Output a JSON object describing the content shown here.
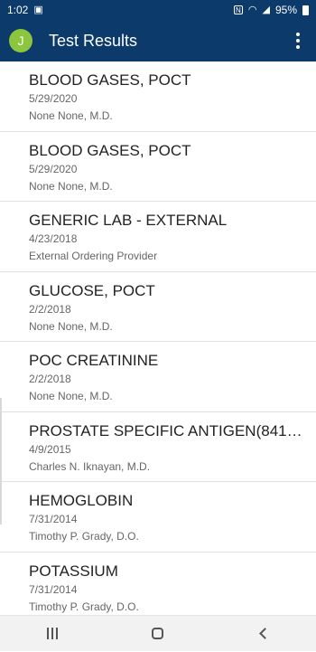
{
  "status_bar": {
    "time": "1:02",
    "battery": "95%",
    "icons": [
      "image-icon",
      "nfc-icon",
      "wifi-icon",
      "signal-icon",
      "battery-icon"
    ]
  },
  "app_bar": {
    "avatar_initial": "J",
    "title": "Test Results",
    "menu_icon": "more-vert-icon"
  },
  "results": [
    {
      "title": "BLOOD GASES, POCT",
      "date": "5/29/2020",
      "provider": "None None, M.D."
    },
    {
      "title": "BLOOD GASES, POCT",
      "date": "5/29/2020",
      "provider": "None None, M.D."
    },
    {
      "title": "GENERIC LAB - EXTERNAL",
      "date": "4/23/2018",
      "provider": "External Ordering Provider"
    },
    {
      "title": "GLUCOSE, POCT",
      "date": "2/2/2018",
      "provider": "None None, M.D."
    },
    {
      "title": "POC CREATININE",
      "date": "2/2/2018",
      "provider": "None None, M.D."
    },
    {
      "title": "PROSTATE SPECIFIC ANTIGEN(841…",
      "date": "4/9/2015",
      "provider": "Charles N. Iknayan, M.D."
    },
    {
      "title": "HEMOGLOBIN",
      "date": "7/31/2014",
      "provider": "Timothy P. Grady, D.O."
    },
    {
      "title": "POTASSIUM",
      "date": "7/31/2014",
      "provider": "Timothy P. Grady, D.O."
    }
  ],
  "nav_bar": {
    "icons": [
      "recents-icon",
      "home-icon",
      "back-icon"
    ]
  },
  "colors": {
    "app_bar": "#0b3a6b",
    "avatar": "#8cc63f",
    "nav_bar": "#f2f2f2"
  }
}
